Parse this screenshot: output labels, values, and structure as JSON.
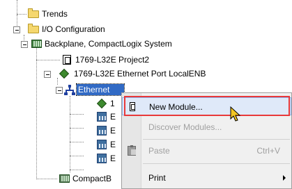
{
  "tree": {
    "trends": "Trends",
    "io_configuration": "I/O Configuration",
    "backplane": "Backplane, CompactLogix System",
    "controller": "1769-L32E Project2",
    "ethernet_port": "1769-L32E Ethernet Port LocalENB",
    "ethernet": "Ethernet",
    "child_1": "1",
    "child_2": "E",
    "child_3": "E",
    "child_4": "E",
    "child_5": "E",
    "compact_bus": "CompactB"
  },
  "context_menu": {
    "items": [
      {
        "label": "New Module...",
        "icon": "new-module-icon",
        "state": "hover"
      },
      {
        "label": "Discover Modules...",
        "icon": "",
        "state": "disabled"
      },
      {
        "label": "Paste",
        "shortcut": "Ctrl+V",
        "icon": "paste-icon",
        "state": "disabled"
      },
      {
        "label": "Print",
        "icon": "",
        "state": "normal",
        "submenu": true
      }
    ]
  },
  "colors": {
    "selection": "#316ac5",
    "highlight_box": "#e8393a",
    "menu_hover": "#dfe9f9"
  }
}
